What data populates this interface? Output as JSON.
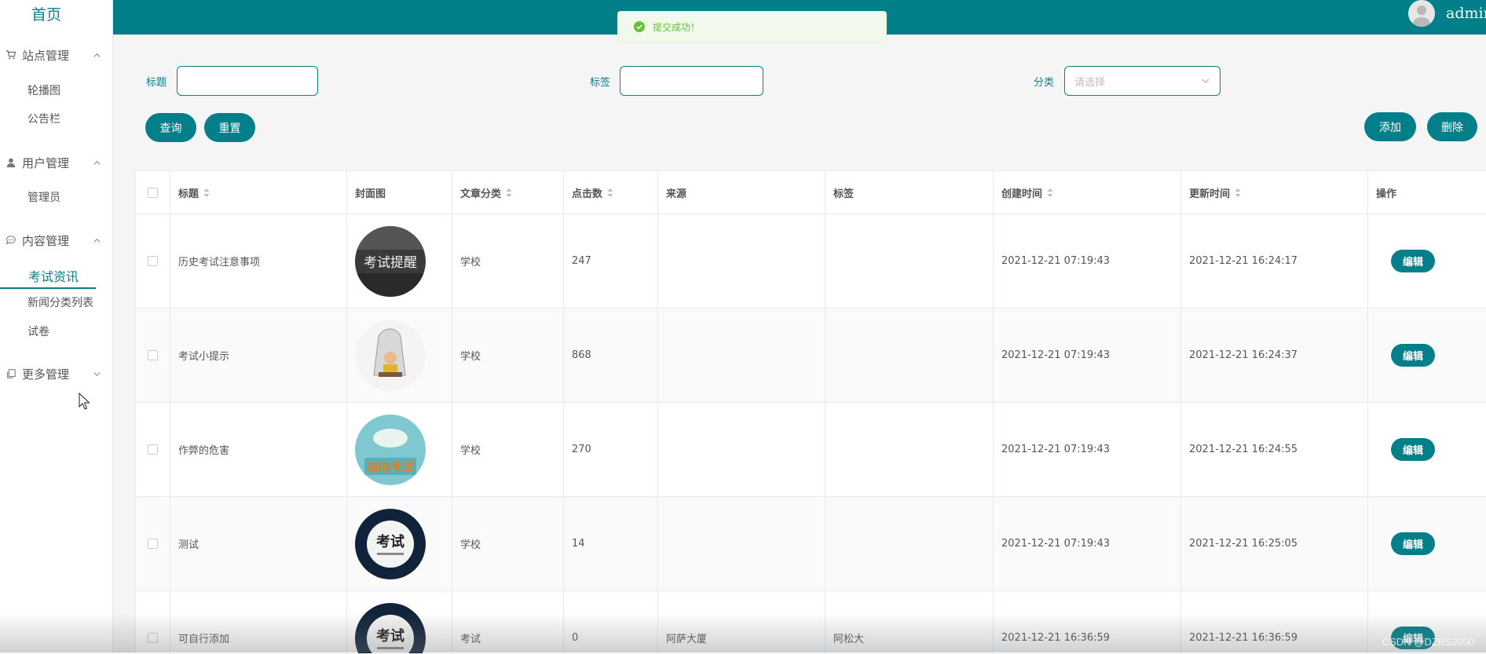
{
  "sidebar": {
    "home": "首页",
    "groups": [
      {
        "label": "站点管理",
        "icon": "cart-icon",
        "expanded": true,
        "items": [
          "轮播图",
          "公告栏"
        ]
      },
      {
        "label": "用户管理",
        "icon": "user-icon",
        "expanded": true,
        "items": [
          "管理员"
        ]
      },
      {
        "label": "内容管理",
        "icon": "chat-icon",
        "expanded": true,
        "items": [
          "考试资讯",
          "新闻分类列表",
          "试卷"
        ],
        "active": "考试资讯"
      },
      {
        "label": "更多管理",
        "icon": "copy-icon",
        "expanded": false,
        "items": []
      }
    ]
  },
  "header": {
    "username": "admin",
    "bg_color": "#037f8a"
  },
  "toast": {
    "message": "提交成功！",
    "type": "success"
  },
  "filters": {
    "title_label": "标题",
    "title_value": "",
    "tag_label": "标签",
    "tag_value": "",
    "category_label": "分类",
    "category_placeholder": "请选择"
  },
  "buttons": {
    "query": "查询",
    "reset": "重置",
    "add": "添加",
    "delete": "删除",
    "edit": "编辑"
  },
  "table": {
    "columns": [
      "标题",
      "封面图",
      "文章分类",
      "点击数",
      "来源",
      "标签",
      "创建时间",
      "更新时间",
      "操作"
    ],
    "rows": [
      {
        "title": "历史考试注意事项",
        "cover": "考试提醒",
        "category": "学校",
        "clicks": "247",
        "source": "",
        "tag": "",
        "created": "2021-12-21 07:19:43",
        "updated": "2021-12-21 16:24:17"
      },
      {
        "title": "考试小提示",
        "cover": "",
        "category": "学校",
        "clicks": "868",
        "source": "",
        "tag": "",
        "created": "2021-12-21 07:19:43",
        "updated": "2021-12-21 16:24:37"
      },
      {
        "title": "作弊的危害",
        "cover": "诚信考试",
        "category": "学校",
        "clicks": "270",
        "source": "",
        "tag": "",
        "created": "2021-12-21 07:19:43",
        "updated": "2021-12-21 16:24:55"
      },
      {
        "title": "测试",
        "cover": "考试",
        "category": "学校",
        "clicks": "14",
        "source": "",
        "tag": "",
        "created": "2021-12-21 07:19:43",
        "updated": "2021-12-21 16:25:05"
      },
      {
        "title": "可自行添加",
        "cover": "考试",
        "category": "考试",
        "clicks": "0",
        "source": "阿萨大厦",
        "tag": "阿松大",
        "created": "2021-12-21 16:36:59",
        "updated": "2021-12-21 16:36:59"
      }
    ]
  },
  "watermark": "CSDN @DZBS2000"
}
